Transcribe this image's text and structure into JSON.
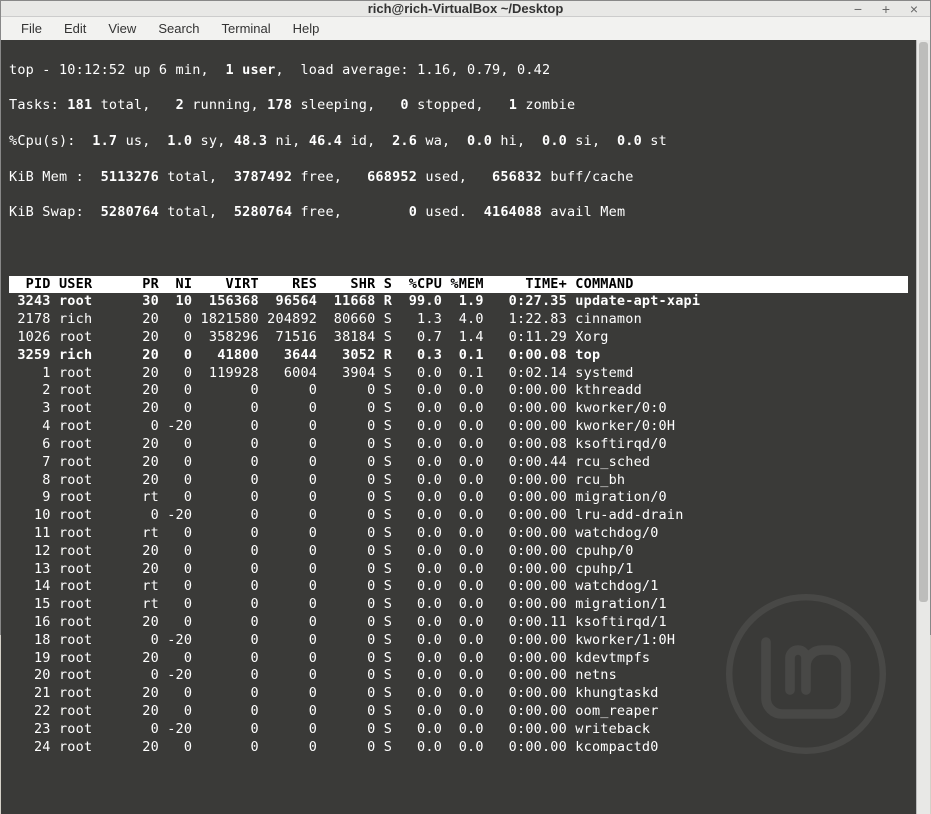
{
  "window": {
    "title": "rich@rich-VirtualBox ~/Desktop"
  },
  "menu": {
    "file": "File",
    "edit": "Edit",
    "view": "View",
    "search": "Search",
    "terminal": "Terminal",
    "help": "Help"
  },
  "top_summary": {
    "line1_pre": "top - ",
    "time": "10:12:52",
    "up_text": " up ",
    "uptime": "6 min",
    "users_pre": ",  ",
    "users": "1 user",
    "load_pre": ",  load average: ",
    "load": "1.16, 0.79, 0.42",
    "tasks_label": "Tasks:",
    "tasks_total": "181",
    "tasks_total_lbl": " total,   ",
    "tasks_running": "2",
    "tasks_running_lbl": " running, ",
    "tasks_sleeping": "178",
    "tasks_sleeping_lbl": " sleeping,   ",
    "tasks_stopped": "0",
    "tasks_stopped_lbl": " stopped,   ",
    "tasks_zombie": "1",
    "tasks_zombie_lbl": " zombie",
    "cpu_label": "%Cpu(s):",
    "cpu_us": "1.7",
    "cpu_us_lbl": " us,  ",
    "cpu_sy": "1.0",
    "cpu_sy_lbl": " sy, ",
    "cpu_ni": "48.3",
    "cpu_ni_lbl": " ni, ",
    "cpu_id": "46.4",
    "cpu_id_lbl": " id,  ",
    "cpu_wa": "2.6",
    "cpu_wa_lbl": " wa,  ",
    "cpu_hi": "0.0",
    "cpu_hi_lbl": " hi,  ",
    "cpu_si": "0.0",
    "cpu_si_lbl": " si,  ",
    "cpu_st": "0.0",
    "cpu_st_lbl": " st",
    "mem_label": "KiB Mem :",
    "mem_total": "5113276",
    "mem_total_lbl": " total,  ",
    "mem_free": "3787492",
    "mem_free_lbl": " free,   ",
    "mem_used": "668952",
    "mem_used_lbl": " used,   ",
    "mem_buff": "656832",
    "mem_buff_lbl": " buff/cache",
    "swap_label": "KiB Swap:",
    "swap_total": "5280764",
    "swap_total_lbl": " total,  ",
    "swap_free": "5280764",
    "swap_free_lbl": " free,        ",
    "swap_used": "0",
    "swap_used_lbl": " used.  ",
    "swap_avail": "4164088",
    "swap_avail_lbl": " avail Mem"
  },
  "columns": [
    "PID",
    "USER",
    "PR",
    "NI",
    "VIRT",
    "RES",
    "SHR",
    "S",
    "%CPU",
    "%MEM",
    "TIME+",
    "COMMAND"
  ],
  "header_rendered": "  PID USER      PR  NI    VIRT    RES    SHR S  %CPU %MEM     TIME+ COMMAND                    ",
  "processes": [
    {
      "pid": 3243,
      "user": "root",
      "pr": "30",
      "ni": "10",
      "virt": "156368",
      "res": "96564",
      "shr": "11668",
      "s": "R",
      "cpu": "99.0",
      "mem": "1.9",
      "time": "0:27.35",
      "cmd": "update-apt-xapi",
      "bold": true
    },
    {
      "pid": 2178,
      "user": "rich",
      "pr": "20",
      "ni": "0",
      "virt": "1821580",
      "res": "204892",
      "shr": "80660",
      "s": "S",
      "cpu": "1.3",
      "mem": "4.0",
      "time": "1:22.83",
      "cmd": "cinnamon",
      "bold": false
    },
    {
      "pid": 1026,
      "user": "root",
      "pr": "20",
      "ni": "0",
      "virt": "358296",
      "res": "71516",
      "shr": "38184",
      "s": "S",
      "cpu": "0.7",
      "mem": "1.4",
      "time": "0:11.29",
      "cmd": "Xorg",
      "bold": false
    },
    {
      "pid": 3259,
      "user": "rich",
      "pr": "20",
      "ni": "0",
      "virt": "41800",
      "res": "3644",
      "shr": "3052",
      "s": "R",
      "cpu": "0.3",
      "mem": "0.1",
      "time": "0:00.08",
      "cmd": "top",
      "bold": true
    },
    {
      "pid": 1,
      "user": "root",
      "pr": "20",
      "ni": "0",
      "virt": "119928",
      "res": "6004",
      "shr": "3904",
      "s": "S",
      "cpu": "0.0",
      "mem": "0.1",
      "time": "0:02.14",
      "cmd": "systemd",
      "bold": false
    },
    {
      "pid": 2,
      "user": "root",
      "pr": "20",
      "ni": "0",
      "virt": "0",
      "res": "0",
      "shr": "0",
      "s": "S",
      "cpu": "0.0",
      "mem": "0.0",
      "time": "0:00.00",
      "cmd": "kthreadd",
      "bold": false
    },
    {
      "pid": 3,
      "user": "root",
      "pr": "20",
      "ni": "0",
      "virt": "0",
      "res": "0",
      "shr": "0",
      "s": "S",
      "cpu": "0.0",
      "mem": "0.0",
      "time": "0:00.00",
      "cmd": "kworker/0:0",
      "bold": false
    },
    {
      "pid": 4,
      "user": "root",
      "pr": "0",
      "ni": "-20",
      "virt": "0",
      "res": "0",
      "shr": "0",
      "s": "S",
      "cpu": "0.0",
      "mem": "0.0",
      "time": "0:00.00",
      "cmd": "kworker/0:0H",
      "bold": false
    },
    {
      "pid": 6,
      "user": "root",
      "pr": "20",
      "ni": "0",
      "virt": "0",
      "res": "0",
      "shr": "0",
      "s": "S",
      "cpu": "0.0",
      "mem": "0.0",
      "time": "0:00.08",
      "cmd": "ksoftirqd/0",
      "bold": false
    },
    {
      "pid": 7,
      "user": "root",
      "pr": "20",
      "ni": "0",
      "virt": "0",
      "res": "0",
      "shr": "0",
      "s": "S",
      "cpu": "0.0",
      "mem": "0.0",
      "time": "0:00.44",
      "cmd": "rcu_sched",
      "bold": false
    },
    {
      "pid": 8,
      "user": "root",
      "pr": "20",
      "ni": "0",
      "virt": "0",
      "res": "0",
      "shr": "0",
      "s": "S",
      "cpu": "0.0",
      "mem": "0.0",
      "time": "0:00.00",
      "cmd": "rcu_bh",
      "bold": false
    },
    {
      "pid": 9,
      "user": "root",
      "pr": "rt",
      "ni": "0",
      "virt": "0",
      "res": "0",
      "shr": "0",
      "s": "S",
      "cpu": "0.0",
      "mem": "0.0",
      "time": "0:00.00",
      "cmd": "migration/0",
      "bold": false
    },
    {
      "pid": 10,
      "user": "root",
      "pr": "0",
      "ni": "-20",
      "virt": "0",
      "res": "0",
      "shr": "0",
      "s": "S",
      "cpu": "0.0",
      "mem": "0.0",
      "time": "0:00.00",
      "cmd": "lru-add-drain",
      "bold": false
    },
    {
      "pid": 11,
      "user": "root",
      "pr": "rt",
      "ni": "0",
      "virt": "0",
      "res": "0",
      "shr": "0",
      "s": "S",
      "cpu": "0.0",
      "mem": "0.0",
      "time": "0:00.00",
      "cmd": "watchdog/0",
      "bold": false
    },
    {
      "pid": 12,
      "user": "root",
      "pr": "20",
      "ni": "0",
      "virt": "0",
      "res": "0",
      "shr": "0",
      "s": "S",
      "cpu": "0.0",
      "mem": "0.0",
      "time": "0:00.00",
      "cmd": "cpuhp/0",
      "bold": false
    },
    {
      "pid": 13,
      "user": "root",
      "pr": "20",
      "ni": "0",
      "virt": "0",
      "res": "0",
      "shr": "0",
      "s": "S",
      "cpu": "0.0",
      "mem": "0.0",
      "time": "0:00.00",
      "cmd": "cpuhp/1",
      "bold": false
    },
    {
      "pid": 14,
      "user": "root",
      "pr": "rt",
      "ni": "0",
      "virt": "0",
      "res": "0",
      "shr": "0",
      "s": "S",
      "cpu": "0.0",
      "mem": "0.0",
      "time": "0:00.00",
      "cmd": "watchdog/1",
      "bold": false
    },
    {
      "pid": 15,
      "user": "root",
      "pr": "rt",
      "ni": "0",
      "virt": "0",
      "res": "0",
      "shr": "0",
      "s": "S",
      "cpu": "0.0",
      "mem": "0.0",
      "time": "0:00.00",
      "cmd": "migration/1",
      "bold": false
    },
    {
      "pid": 16,
      "user": "root",
      "pr": "20",
      "ni": "0",
      "virt": "0",
      "res": "0",
      "shr": "0",
      "s": "S",
      "cpu": "0.0",
      "mem": "0.0",
      "time": "0:00.11",
      "cmd": "ksoftirqd/1",
      "bold": false
    },
    {
      "pid": 18,
      "user": "root",
      "pr": "0",
      "ni": "-20",
      "virt": "0",
      "res": "0",
      "shr": "0",
      "s": "S",
      "cpu": "0.0",
      "mem": "0.0",
      "time": "0:00.00",
      "cmd": "kworker/1:0H",
      "bold": false
    },
    {
      "pid": 19,
      "user": "root",
      "pr": "20",
      "ni": "0",
      "virt": "0",
      "res": "0",
      "shr": "0",
      "s": "S",
      "cpu": "0.0",
      "mem": "0.0",
      "time": "0:00.00",
      "cmd": "kdevtmpfs",
      "bold": false
    },
    {
      "pid": 20,
      "user": "root",
      "pr": "0",
      "ni": "-20",
      "virt": "0",
      "res": "0",
      "shr": "0",
      "s": "S",
      "cpu": "0.0",
      "mem": "0.0",
      "time": "0:00.00",
      "cmd": "netns",
      "bold": false
    },
    {
      "pid": 21,
      "user": "root",
      "pr": "20",
      "ni": "0",
      "virt": "0",
      "res": "0",
      "shr": "0",
      "s": "S",
      "cpu": "0.0",
      "mem": "0.0",
      "time": "0:00.00",
      "cmd": "khungtaskd",
      "bold": false
    },
    {
      "pid": 22,
      "user": "root",
      "pr": "20",
      "ni": "0",
      "virt": "0",
      "res": "0",
      "shr": "0",
      "s": "S",
      "cpu": "0.0",
      "mem": "0.0",
      "time": "0:00.00",
      "cmd": "oom_reaper",
      "bold": false
    },
    {
      "pid": 23,
      "user": "root",
      "pr": "0",
      "ni": "-20",
      "virt": "0",
      "res": "0",
      "shr": "0",
      "s": "S",
      "cpu": "0.0",
      "mem": "0.0",
      "time": "0:00.00",
      "cmd": "writeback",
      "bold": false
    },
    {
      "pid": 24,
      "user": "root",
      "pr": "20",
      "ni": "0",
      "virt": "0",
      "res": "0",
      "shr": "0",
      "s": "S",
      "cpu": "0.0",
      "mem": "0.0",
      "time": "0:00.00",
      "cmd": "kcompactd0",
      "bold": false
    }
  ]
}
